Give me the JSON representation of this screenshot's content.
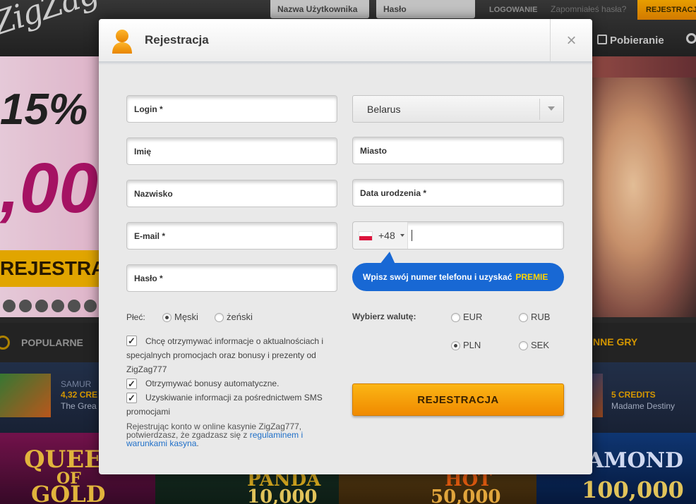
{
  "background": {
    "top_bar": {
      "username_placeholder": "Nazwa Użytkownika",
      "password_placeholder": "Hasło",
      "login_button": "LOGOWANIE",
      "forgot_link": "Zapomniałeś hasła?",
      "register_button": "REJESTRACJA",
      "download_label": "Pobieranie"
    },
    "banner": {
      "promo_percent": "15% ",
      "promo_amount": ",00",
      "register_strip": "REJESTRA"
    },
    "category_bar": {
      "popular_label": "POPULARNE",
      "other_label": "NNE GRY"
    },
    "game_row": {
      "left_game_name": "SAMUR",
      "left_credits": "4,32 CRE",
      "left_sub": "The Grea",
      "right_credits": "5 CREDITS",
      "right_game_name": "Madame Destiny"
    },
    "game_tiles": {
      "queen_line1": "QUEEN",
      "queen_line2": "OF",
      "queen_line3": "GOLD",
      "panda_title": "PANDA",
      "panda_value": "10,000",
      "hot_title": "HOT",
      "hot_value": "50,000",
      "diamond_title": "AMOND",
      "diamond_value": "100,000"
    }
  },
  "modal": {
    "title": "Rejestracja",
    "close_symbol": "×",
    "left_fields": {
      "login": "Login *",
      "first_name": "Imię",
      "last_name": "Nazwisko",
      "email": "E-mail *",
      "password": "Hasło *"
    },
    "right_fields": {
      "country_value": "Belarus",
      "city": "Miasto",
      "birth_date": "Data urodzenia *",
      "phone_code": "+48",
      "phone_value": ""
    },
    "phone_hint": {
      "text": "Wpisz swój numer telefonu i uzyskać",
      "highlight": "PREMIE"
    },
    "gender": {
      "label": "Płeć:",
      "male": "Męski",
      "female": "żeński",
      "selected": "Męski"
    },
    "currency": {
      "label": "Wybierz walutę:",
      "options": [
        "EUR",
        "RUB",
        "PLN",
        "SEK"
      ],
      "selected": "PLN"
    },
    "checkboxes": {
      "news_line1": "Chcę otrzymywać informacje o aktualnościach i",
      "news_line2": "specjalnych promocjach oraz bonusy i prezenty od",
      "news_line3": "ZigZag777",
      "auto_bonus": "Otrzymywać bonusy automatyczne.",
      "sms_line1": "Uzyskiwanie informacji za pośrednictwem SMS",
      "sms_line2": "promocjami",
      "news_checked": true,
      "auto_bonus_checked": true,
      "sms_checked": true
    },
    "terms": {
      "text": "Rejestrując konto w online kasynie ZigZag777, potwierdzasz, że zgadzasz się z ",
      "link": "regulaminem i warunkami kasyna",
      "end": "."
    },
    "submit_label": "REJESTRACJA"
  },
  "colors": {
    "accent_orange": "#f5a000",
    "phone_bubble_blue": "#1868d4",
    "premie_yellow": "#ffd400"
  }
}
